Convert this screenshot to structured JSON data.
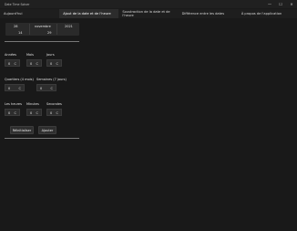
{
  "window": {
    "title": "Date Time Solver",
    "controls": {
      "minimize": "—",
      "maximize": "☐",
      "close": "✕"
    }
  },
  "tabs": [
    {
      "label": "Aujourd'hui",
      "active": false
    },
    {
      "label": "Ajout de la date et de l'heure",
      "active": true
    },
    {
      "label": "Soustraction de la date et de l'heure",
      "active": false
    },
    {
      "label": "Différence entre les dates",
      "active": false
    },
    {
      "label": "À propos de l'application",
      "active": false
    }
  ],
  "date_picker": {
    "day": "28",
    "month": "novembre",
    "year": "2021",
    "hour": "14",
    "minute": "29"
  },
  "fields": {
    "years": {
      "label": "Années",
      "value": "0",
      "clear": "C"
    },
    "months": {
      "label": "Mois",
      "value": "0",
      "clear": "C"
    },
    "days": {
      "label": "Jours",
      "value": "0",
      "clear": "C"
    },
    "quarters": {
      "label": "Quartiers (4 mois)",
      "value": "0",
      "clear": "C"
    },
    "weeks": {
      "label": "Semaines (7 jours)",
      "value": "0",
      "clear": "C"
    },
    "hours": {
      "label": "Les heures",
      "value": "0",
      "clear": "C"
    },
    "minutes": {
      "label": "Minutes",
      "value": "0",
      "clear": "C"
    },
    "seconds": {
      "label": "Secondes",
      "value": "0",
      "clear": "C"
    }
  },
  "buttons": {
    "reset": "Réinitialiser",
    "add": "Ajouter"
  }
}
